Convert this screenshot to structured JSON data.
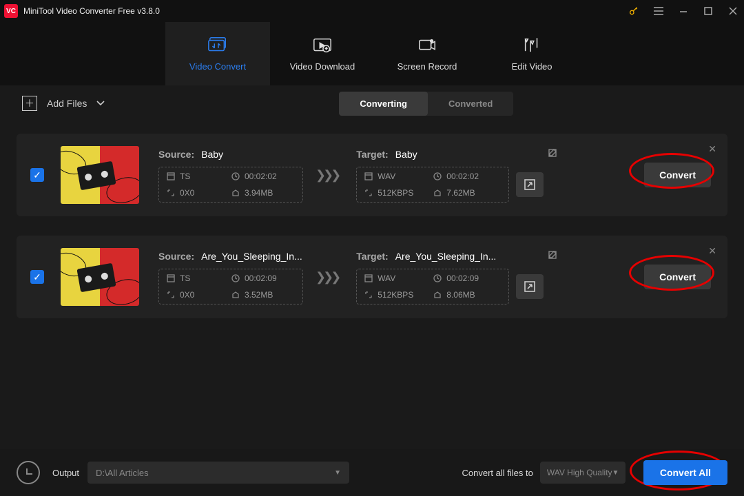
{
  "titlebar": {
    "title": "MiniTool Video Converter Free v3.8.0"
  },
  "maintabs": {
    "convert": "Video Convert",
    "download": "Video Download",
    "record": "Screen Record",
    "edit": "Edit Video"
  },
  "toolbar": {
    "addfiles": "Add Files",
    "seg_converting": "Converting",
    "seg_converted": "Converted"
  },
  "labels": {
    "source": "Source:",
    "target": "Target:",
    "convert": "Convert"
  },
  "files": [
    {
      "source_name": "Baby",
      "target_name": "Baby",
      "src": {
        "format": "TS",
        "duration": "00:02:02",
        "res": "0X0",
        "size": "3.94MB"
      },
      "tgt": {
        "format": "WAV",
        "duration": "00:02:02",
        "bitrate": "512KBPS",
        "size": "7.62MB"
      }
    },
    {
      "source_name": "Are_You_Sleeping_In...",
      "target_name": "Are_You_Sleeping_In...",
      "src": {
        "format": "TS",
        "duration": "00:02:09",
        "res": "0X0",
        "size": "3.52MB"
      },
      "tgt": {
        "format": "WAV",
        "duration": "00:02:09",
        "bitrate": "512KBPS",
        "size": "8.06MB"
      }
    }
  ],
  "bottom": {
    "output_label": "Output",
    "output_path": "D:\\All Articles",
    "convert_all_label": "Convert all files to",
    "format_selected": "WAV High Quality",
    "convert_all_btn": "Convert All"
  }
}
